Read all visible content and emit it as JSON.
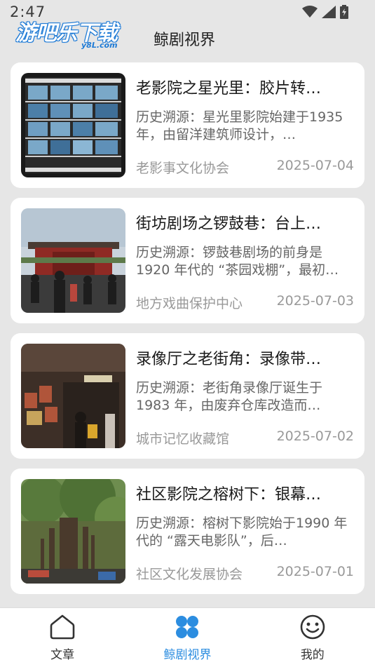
{
  "status_bar": {
    "time": "2:47"
  },
  "watermark": {
    "text": "游吧乐下载",
    "sub": "y8L.com"
  },
  "header": {
    "title": "鲸剧视界"
  },
  "articles": [
    {
      "title": "老影院之星光里：胶片转…",
      "summary": "历史溯源：星光里影院始建于1935 年，由留洋建筑师设计，…",
      "source": "老影事文化协会",
      "date": "2025-07-04",
      "thumb_icon": "film-strip-image"
    },
    {
      "title": "街坊剧场之锣鼓巷：台上…",
      "summary": "历史溯源：锣鼓巷剧场的前身是1920 年代的 “茶园戏棚”，最初…",
      "source": "地方戏曲保护中心",
      "date": "2025-07-03",
      "thumb_icon": "street-crowd-image"
    },
    {
      "title": "录像厅之老街角：录像带…",
      "summary": "历史溯源：老街角录像厅诞生于 1983 年，由废弃仓库改造而…",
      "source": "城市记忆收藏馆",
      "date": "2025-07-02",
      "thumb_icon": "video-hall-image"
    },
    {
      "title": "社区影院之榕树下：银幕…",
      "summary": "历史溯源：榕树下影院始于1990 年代的 “露天电影队”，后…",
      "source": "社区文化发展协会",
      "date": "2025-07-01",
      "thumb_icon": "banyan-tree-image"
    }
  ],
  "nav": {
    "items": [
      {
        "label": "文章",
        "icon": "home-icon"
      },
      {
        "label": "鲸剧视界",
        "icon": "grid-icon"
      },
      {
        "label": "我的",
        "icon": "smiley-icon"
      }
    ],
    "active_index": 1
  },
  "colors": {
    "accent": "#2c8de0",
    "background": "#e6e6e6",
    "card": "#ffffff"
  }
}
